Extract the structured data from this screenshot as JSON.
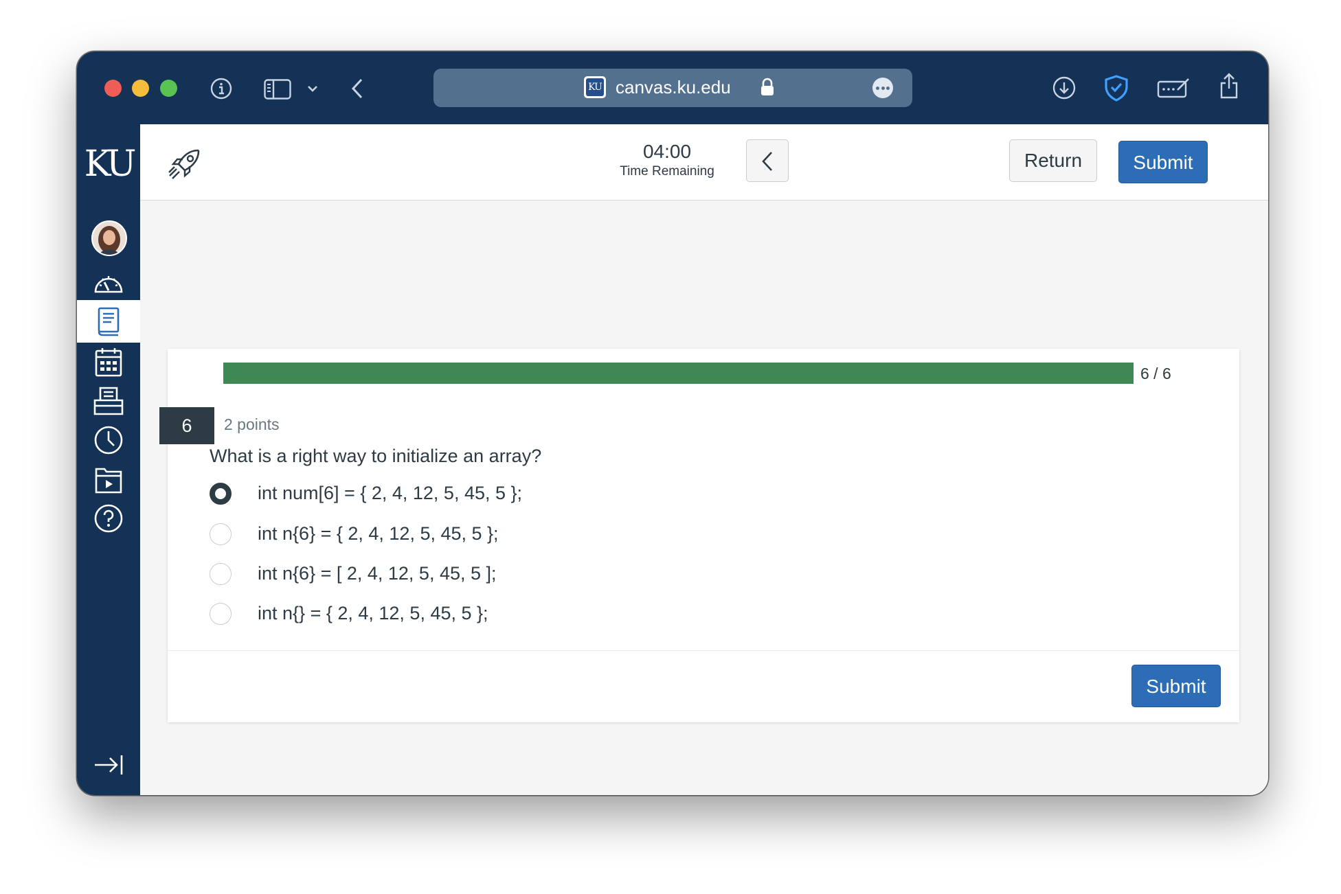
{
  "browser": {
    "url": "canvas.ku.edu",
    "favicon_text": "KU",
    "icons": [
      "info-icon",
      "sidebar-icon",
      "chevron-down-icon",
      "back-icon",
      "lock-icon",
      "more-icon",
      "download-icon",
      "shield-icon",
      "password-icon",
      "share-icon"
    ]
  },
  "global_nav": {
    "logo": "KU",
    "active_item": "courses",
    "items": [
      "account",
      "dashboard",
      "courses",
      "calendar",
      "inbox",
      "history",
      "studio",
      "help",
      "collapse"
    ]
  },
  "quiz": {
    "timer": {
      "value": "04:00",
      "label": "Time Remaining"
    },
    "return_label": "Return",
    "submit_label": "Submit",
    "progress": {
      "current": 6,
      "total": 6,
      "text": "6 / 6",
      "fraction": 1.0
    },
    "question": {
      "number": "6",
      "points": "2 points",
      "text": "What is a right way to initialize an array?",
      "answers": [
        {
          "label": "int num[6] = { 2, 4, 12, 5, 45, 5 };",
          "selected": true
        },
        {
          "label": "int n{6} = { 2, 4, 12, 5, 45, 5 };",
          "selected": false
        },
        {
          "label": "int n{6} = [ 2, 4, 12, 5, 45, 5 ];",
          "selected": false
        },
        {
          "label": "int n{} = { 2, 4, 12, 5, 45, 5 };",
          "selected": false
        }
      ]
    },
    "footer_submit_label": "Submit"
  },
  "colors": {
    "nav_bg": "#143156",
    "progress": "#3e8853",
    "submit": "#2d6db5",
    "text": "#2d3b45"
  }
}
